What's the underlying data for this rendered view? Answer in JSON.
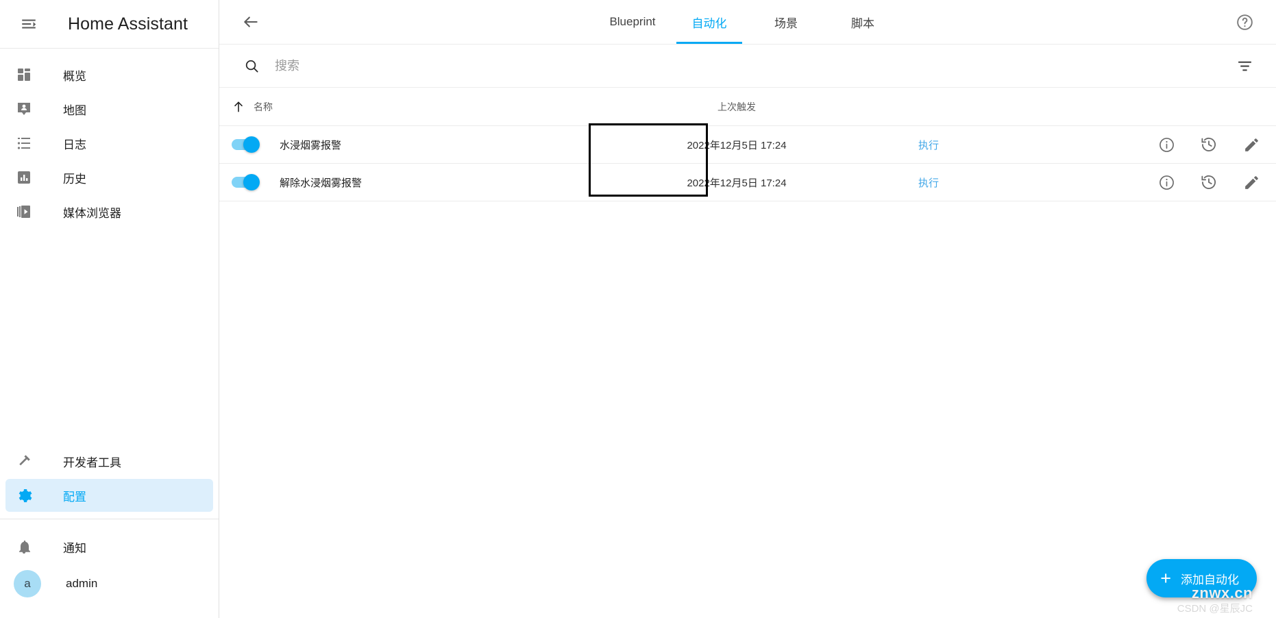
{
  "sidebar": {
    "menu_icon": "menu-collapse-icon",
    "title": "Home Assistant",
    "items": [
      {
        "label": "概览",
        "icon": "dashboard-icon",
        "active": false
      },
      {
        "label": "地图",
        "icon": "map-marker-icon",
        "active": false
      },
      {
        "label": "日志",
        "icon": "logbook-list-icon",
        "active": false
      },
      {
        "label": "历史",
        "icon": "history-chart-icon",
        "active": false
      },
      {
        "label": "媒体浏览器",
        "icon": "media-browser-icon",
        "active": false
      }
    ],
    "bottom_items": [
      {
        "label": "开发者工具",
        "icon": "hammer-icon",
        "active": false
      },
      {
        "label": "配置",
        "icon": "gear-icon",
        "active": true
      }
    ],
    "notifications": {
      "label": "通知",
      "icon": "bell-icon"
    },
    "user": {
      "name": "admin",
      "avatar_initial": "a"
    }
  },
  "toolbar": {
    "back_icon": "arrow-left-icon",
    "help_icon": "help-circle-icon",
    "tabs": [
      {
        "label": "Blueprint",
        "active": false
      },
      {
        "label": "自动化",
        "active": true
      },
      {
        "label": "场景",
        "active": false
      },
      {
        "label": "脚本",
        "active": false
      }
    ]
  },
  "search": {
    "icon": "search-icon",
    "placeholder": "搜索",
    "value": "",
    "filter_icon": "filter-icon"
  },
  "table": {
    "columns": {
      "name": "名称",
      "last_triggered": "上次触发",
      "sort_icon": "sort-ascending-arrow-icon"
    },
    "rows": [
      {
        "name": "水浸烟雾报警",
        "enabled": true,
        "last_triggered": "2022年12月5日 17:24",
        "execute_label": "执行",
        "actions": [
          "info-icon",
          "history-icon",
          "pencil-edit-icon"
        ]
      },
      {
        "name": "解除水浸烟雾报警",
        "enabled": true,
        "last_triggered": "2022年12月5日 17:24",
        "execute_label": "执行",
        "actions": [
          "info-icon",
          "history-icon",
          "pencil-edit-icon"
        ]
      }
    ]
  },
  "fab": {
    "icon": "plus-icon",
    "label": "添加自动化"
  },
  "watermark": {
    "main": "znwx.cn",
    "sub": "CSDN @星辰JC"
  },
  "colors": {
    "accent": "#03a9f4",
    "active_nav_bg": "#ddeffc",
    "text_primary": "#212121",
    "text_secondary": "#5e5e5e",
    "border": "#ececec",
    "highlight_outline": "#000000"
  }
}
